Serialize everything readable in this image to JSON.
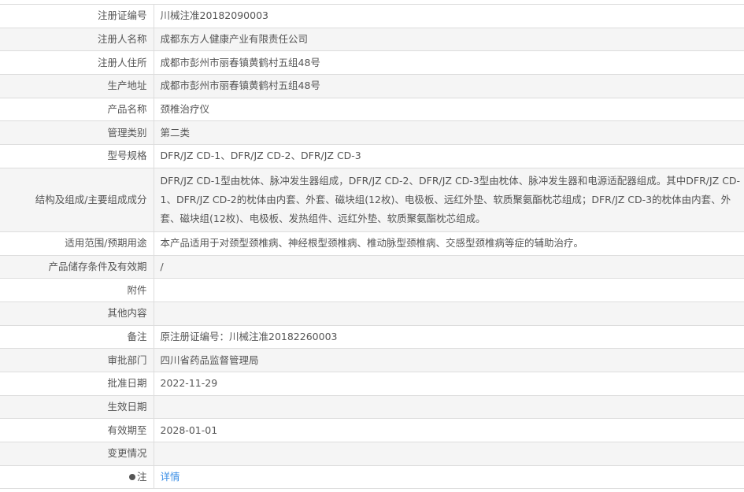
{
  "rows": [
    {
      "label": "注册证编号",
      "value": "川械注准20182090003"
    },
    {
      "label": "注册人名称",
      "value": "成都东方人健康产业有限责任公司"
    },
    {
      "label": "注册人住所",
      "value": "成都市彭州市丽春镇黄鹤村五组48号"
    },
    {
      "label": "生产地址",
      "value": "成都市彭州市丽春镇黄鹤村五组48号"
    },
    {
      "label": "产品名称",
      "value": "颈椎治疗仪"
    },
    {
      "label": "管理类别",
      "value": "第二类"
    },
    {
      "label": "型号规格",
      "value": "DFR/JZ CD-1、DFR/JZ CD-2、DFR/JZ CD-3"
    },
    {
      "label": "结构及组成/主要组成成分",
      "value": "DFR/JZ CD-1型由枕体、脉冲发生器组成，DFR/JZ CD-2、DFR/JZ CD-3型由枕体、脉冲发生器和电源适配器组成。其中DFR/JZ CD-1、DFR/JZ CD-2的枕体由内套、外套、磁块组(12枚)、电极板、远红外垫、软质聚氨酯枕芯组成；DFR/JZ CD-3的枕体由内套、外套、磁块组(12枚)、电极板、发热组件、远红外垫、软质聚氨酯枕芯组成。"
    },
    {
      "label": "适用范围/预期用途",
      "value": "本产品适用于对颈型颈椎病、神经根型颈椎病、椎动脉型颈椎病、交感型颈椎病等症的辅助治疗。"
    },
    {
      "label": "产品储存条件及有效期",
      "value": "/"
    },
    {
      "label": "附件",
      "value": ""
    },
    {
      "label": "其他内容",
      "value": ""
    },
    {
      "label": "备注",
      "value": "原注册证编号：川械注准20182260003"
    },
    {
      "label": "审批部门",
      "value": "四川省药品监督管理局"
    },
    {
      "label": "批准日期",
      "value": "2022-11-29"
    },
    {
      "label": "生效日期",
      "value": ""
    },
    {
      "label": "有效期至",
      "value": "2028-01-01"
    },
    {
      "label": "变更情况",
      "value": ""
    }
  ],
  "note": {
    "label": "注",
    "link": "详情"
  }
}
